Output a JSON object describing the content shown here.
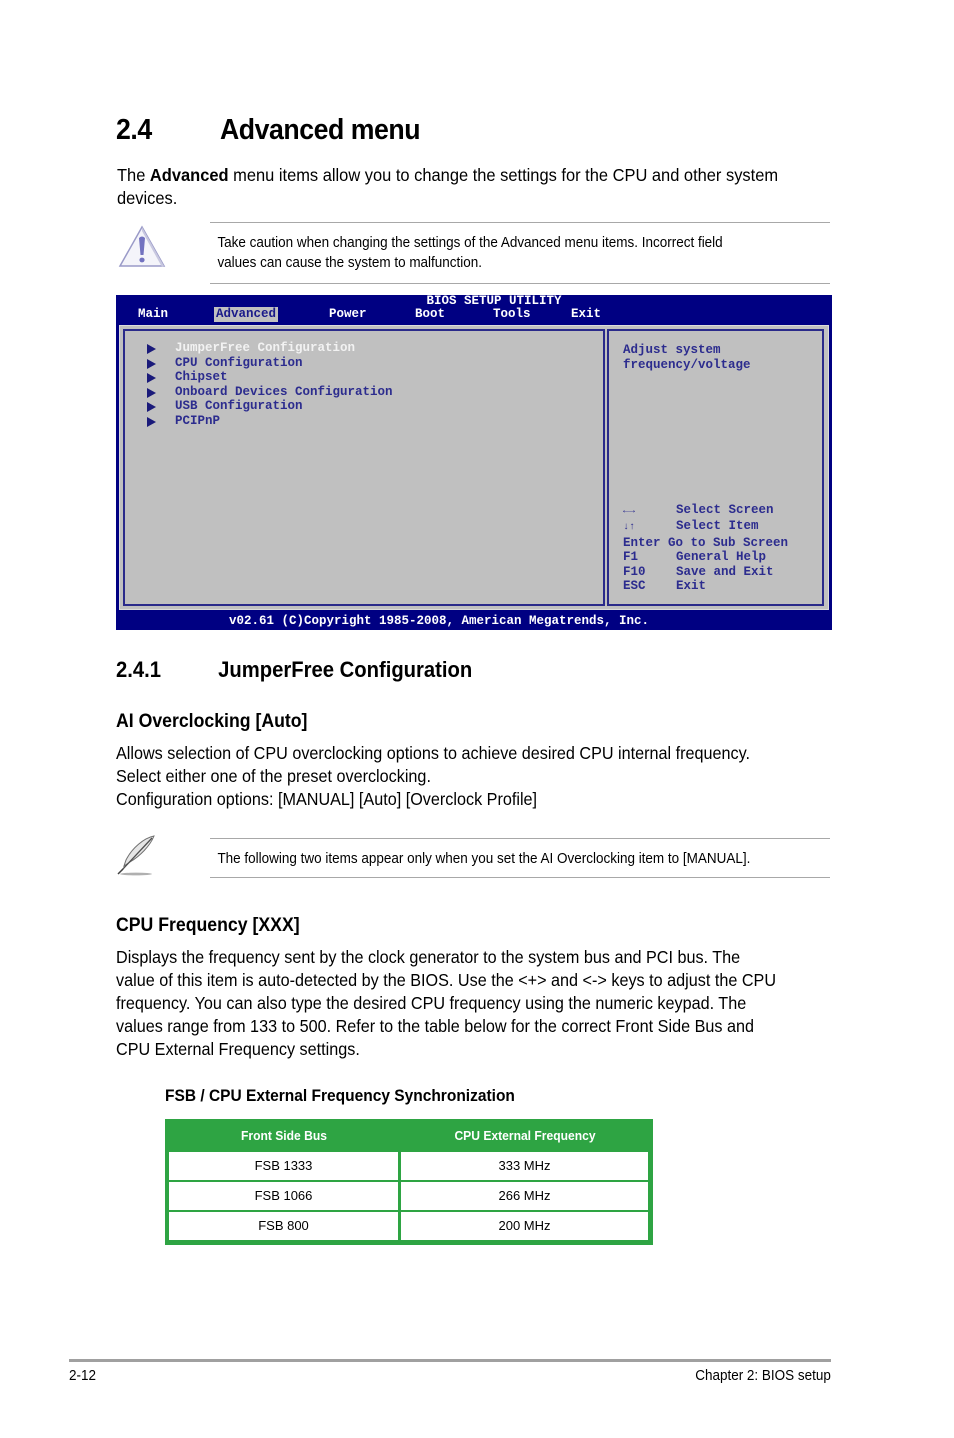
{
  "section": {
    "number": "2.4",
    "title": "Advanced menu",
    "intro_prefix": "The ",
    "intro_bold": "Advanced",
    "intro_suffix": " menu items allow you to change the settings for the CPU and other system devices."
  },
  "caution_note": {
    "icon": "warning-triangle-icon",
    "lines": [
      "Take caution when changing the settings of the Advanced menu items. Incorrect field",
      "values can cause the system to malfunction."
    ]
  },
  "bios": {
    "title": "BIOS SETUP UTILITY",
    "menu": [
      {
        "label": "Main",
        "selected": false
      },
      {
        "label": "Advanced",
        "selected": true
      },
      {
        "label": "Power",
        "selected": false
      },
      {
        "label": "Boot",
        "selected": false
      },
      {
        "label": "Tools",
        "selected": false
      },
      {
        "label": "Exit",
        "selected": false
      }
    ],
    "items": [
      {
        "label": "JumperFree Configuration",
        "active": true
      },
      {
        "label": "CPU Configuration",
        "active": false
      },
      {
        "label": "Chipset",
        "active": false
      },
      {
        "label": "Onboard Devices Configuration",
        "active": false
      },
      {
        "label": "USB Configuration",
        "active": false
      },
      {
        "label": "PCIPnP",
        "active": false
      }
    ],
    "help_text": [
      "Adjust system",
      "frequency/voltage"
    ],
    "keys": [
      {
        "key": "←→",
        "action": "Select Screen"
      },
      {
        "key": "↓↑",
        "action": "Select Item"
      },
      {
        "key": "Enter",
        "action": "Go to Sub Screen"
      },
      {
        "key": "F1",
        "action": "General Help"
      },
      {
        "key": "F10",
        "action": "Save and Exit"
      },
      {
        "key": "ESC",
        "action": "Exit"
      }
    ],
    "footer": "v02.61 (C)Copyright 1985-2008, American Megatrends, Inc.",
    "colors": {
      "frame": "#000082",
      "panel": "#c0c0c0",
      "text": "#2c2c8e",
      "active": "#f2f2f2"
    }
  },
  "subsection": {
    "number": "2.4.1",
    "title": "JumperFree Configuration"
  },
  "ai_overclocking": {
    "heading": "AI Overclocking [Auto]",
    "lines": [
      "Allows selection of CPU overclocking options to achieve desired CPU internal frequency.",
      "Select either one of the preset overclocking.",
      "Configuration options: [MANUAL] [Auto] [Overclock Profile]"
    ]
  },
  "manual_note": {
    "icon": "note-feather-icon",
    "text": "The following two items appear only when you set the AI Overclocking item to [MANUAL]."
  },
  "cpu_frequency": {
    "heading": "CPU Frequency [XXX]",
    "lines": [
      "Displays the frequency sent by the clock generator to the system bus and PCI bus. The",
      "value of this item is auto-detected by the BIOS. Use the <+> and <-> keys to adjust the CPU",
      "frequency. You can also type the desired CPU frequency using the numeric keypad. The",
      "values range from 133 to 500. Refer to the table below for the correct Front Side Bus and",
      "CPU External Frequency settings."
    ]
  },
  "fsb_table": {
    "caption": "FSB / CPU External Frequency Synchronization",
    "headers": [
      "Front Side Bus",
      "CPU External Frequency"
    ],
    "rows": [
      [
        "FSB 1333",
        "333 MHz"
      ],
      [
        "FSB 1066",
        "266 MHz"
      ],
      [
        "FSB 800",
        "200 MHz"
      ]
    ],
    "accent": "#2ea443"
  },
  "footer": {
    "page_number": "2-12",
    "chapter": "Chapter 2: BIOS setup"
  }
}
